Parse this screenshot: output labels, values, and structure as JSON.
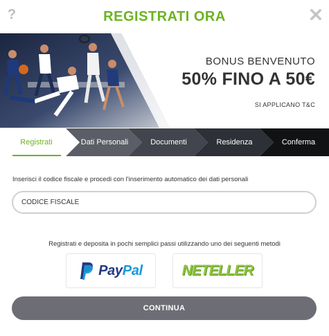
{
  "header": {
    "title": "REGISTRATI ORA",
    "help_icon": "?",
    "close_icon": "close-icon"
  },
  "banner": {
    "line1": "BONUS BENVENUTO",
    "line2": "50% FINO A 50€",
    "line3": "SI APPLICANO T&C"
  },
  "steps": [
    {
      "label": "Registrati",
      "active": true
    },
    {
      "label": "Dati Personali",
      "active": false
    },
    {
      "label": "Documenti",
      "active": false
    },
    {
      "label": "Residenza",
      "active": false
    },
    {
      "label": "Conferma",
      "active": false
    }
  ],
  "form": {
    "cf_label": "Inserisci il codice fiscale e procedi con l'inserimento automatico dei dati personali",
    "cf_placeholder": "CODICE FISCALE",
    "cf_value": ""
  },
  "payment": {
    "label": "Registrati e deposita in pochi semplici passi utilizzando uno dei seguenti metodi",
    "paypal": {
      "pay": "Pay",
      "pal": "Pal"
    },
    "neteller": "NETELLER"
  },
  "continue_label": "CONTINUA",
  "colors": {
    "accent_green": "#6bb320",
    "step_active_text": "#6bb320",
    "step_dark": "#2b2d33",
    "button_gray": "#6d6e75",
    "paypal_dark": "#253b80",
    "paypal_light": "#179bd7",
    "neteller_green": "#8dc63f"
  }
}
